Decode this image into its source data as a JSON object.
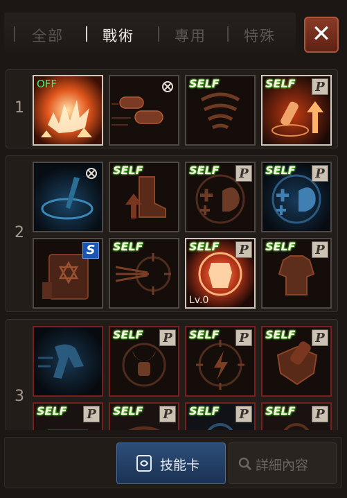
{
  "tabs": [
    {
      "label": "全部",
      "active": false
    },
    {
      "label": "戰術",
      "active": true
    },
    {
      "label": "專用",
      "active": false
    },
    {
      "label": "特殊",
      "active": false
    }
  ],
  "close_icon": "close-icon",
  "groups": [
    {
      "number": "1"
    },
    {
      "number": "2"
    },
    {
      "number": "3"
    }
  ],
  "badges": {
    "self": "SELF",
    "passive": "P",
    "special": "S",
    "off": "OFF",
    "level": "Lv.0"
  },
  "footer": {
    "skill_card_label": "技能卡",
    "details_label": "詳細內容",
    "skill_card_icon": "card-icon",
    "details_icon": "search-icon"
  },
  "colors": {
    "self_glow": "#7fff5a",
    "off_text": "#3cf07a",
    "active_button": "#2d4e78",
    "close_button": "#8a3b26"
  }
}
